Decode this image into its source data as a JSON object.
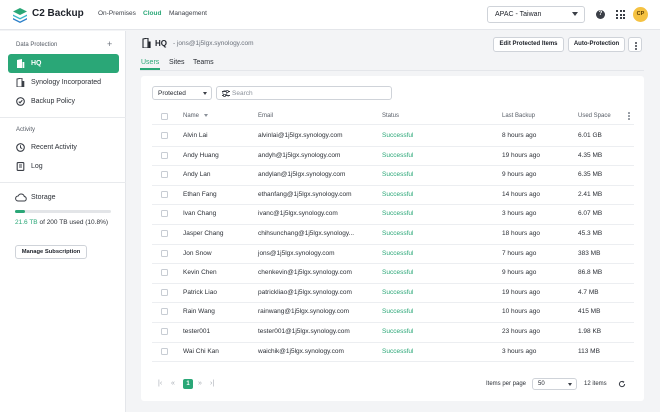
{
  "app": {
    "brand": "C2 Backup",
    "nav": [
      "On-Premises",
      "Cloud",
      "Management"
    ],
    "active_nav": "Cloud",
    "region": "APAC - Taiwan",
    "avatar_initials": "CP",
    "help_glyph": "?"
  },
  "sidebar": {
    "data_protection_title": "Data Protection",
    "add_glyph": "+",
    "items": [
      {
        "label": "HQ",
        "icon": "building-icon"
      },
      {
        "label": "Synology Incorporated",
        "icon": "building-icon"
      },
      {
        "label": "Backup Policy",
        "icon": "policy-icon"
      }
    ],
    "activity_title": "Activity",
    "activity_items": [
      {
        "label": "Recent Activity",
        "icon": "clock-icon"
      },
      {
        "label": "Log",
        "icon": "log-icon"
      }
    ],
    "storage": {
      "title": "Storage",
      "used": "21.6 TB",
      "rest": " of 200 TB used",
      "percent": "(10.8%)",
      "fraction": 0.108,
      "manage_label": "Manage Subscription"
    }
  },
  "header": {
    "title": "HQ",
    "subtitle": "- jons@1j5lgx.synology.com",
    "edit_button": "Edit Protected Items",
    "auto_button": "Auto-Protection"
  },
  "tabs": [
    "Users",
    "Sites",
    "Teams"
  ],
  "active_tab": "Users",
  "toolbar": {
    "filter_value": "Protected",
    "search_placeholder": "Search"
  },
  "table": {
    "columns": [
      "Name",
      "Email",
      "Status",
      "Last Backup",
      "Used Space"
    ],
    "rows": [
      {
        "name": "Alvin Lai",
        "email": "alvinlai@1j5lgx.synology.com",
        "status": "Successful",
        "last_backup": "8 hours ago",
        "used": "6.01 GB"
      },
      {
        "name": "Andy Huang",
        "email": "andyh@1j5lgx.synology.com",
        "status": "Successful",
        "last_backup": "19 hours ago",
        "used": "4.35 MB"
      },
      {
        "name": "Andy Lan",
        "email": "andylan@1j5lgx.synology.com",
        "status": "Successful",
        "last_backup": "9 hours ago",
        "used": "6.35 MB"
      },
      {
        "name": "Ethan Fang",
        "email": "ethanfang@1j5lgx.synology.com",
        "status": "Successful",
        "last_backup": "14 hours ago",
        "used": "2.41 MB"
      },
      {
        "name": "Ivan Chang",
        "email": "ivanc@1j5lgx.synology.com",
        "status": "Successful",
        "last_backup": "3 hours ago",
        "used": "6.07 MB"
      },
      {
        "name": "Jasper Chang",
        "email": "chihsunchang@1j5lgx.synology...",
        "status": "Successful",
        "last_backup": "18 hours ago",
        "used": "45.3 MB"
      },
      {
        "name": "Jon Snow",
        "email": "jons@1j5lgx.synology.com",
        "status": "Successful",
        "last_backup": "7 hours ago",
        "used": "383 MB"
      },
      {
        "name": "Kevin Chen",
        "email": "chenkevin@1j5lgx.synology.com",
        "status": "Successful",
        "last_backup": "9 hours ago",
        "used": "86.8 MB"
      },
      {
        "name": "Patrick Liao",
        "email": "patrickliao@1j5lgx.synology.com",
        "status": "Successful",
        "last_backup": "19 hours ago",
        "used": "4.7 MB"
      },
      {
        "name": "Rain Wang",
        "email": "rainwang@1j5lgx.synology.com",
        "status": "Successful",
        "last_backup": "10 hours ago",
        "used": "415 MB"
      },
      {
        "name": "tester001",
        "email": "tester001@1j5lgx.synology.com",
        "status": "Successful",
        "last_backup": "23 hours ago",
        "used": "1.98 KB"
      },
      {
        "name": "Wai Chi Kan",
        "email": "waichik@1j5lgx.synology.com",
        "status": "Successful",
        "last_backup": "3 hours ago",
        "used": "113 MB"
      }
    ]
  },
  "pagination": {
    "current_page": "1",
    "items_per_page_label": "Items per page",
    "items_per_page": "50",
    "total": "12 items"
  },
  "colors": {
    "accent": "#2aa777"
  }
}
